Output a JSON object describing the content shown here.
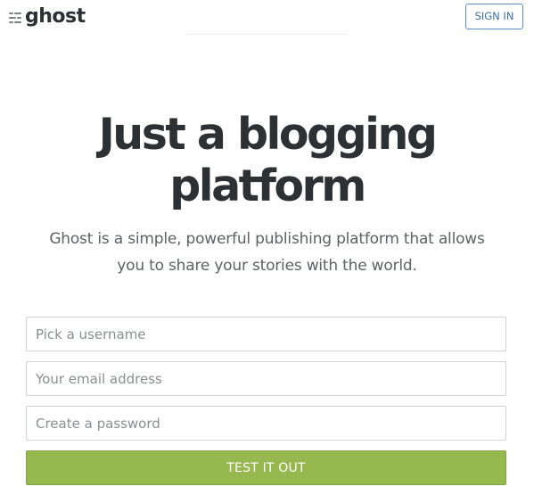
{
  "header": {
    "logo_text": "ghost",
    "logo_icon": "ghost-logo-icon",
    "signin_label": "SIGN IN"
  },
  "hero": {
    "title_line1": "Just a blogging",
    "title_line2": "platform",
    "subtitle_line1": "Ghost is a simple, powerful publishing platform that allows",
    "subtitle_line2": "you to share your stories with the world."
  },
  "form": {
    "username_placeholder": "Pick a username",
    "username_value": "",
    "email_placeholder": "Your email address",
    "email_value": "",
    "password_placeholder": "Create a password",
    "password_value": "",
    "submit_label": "TEST IT OUT"
  },
  "colors": {
    "brand_text": "#2c3032",
    "signin_blue": "#3b6fae",
    "submit_green": "#97b74f",
    "subtitle_gray": "#5d6164"
  }
}
